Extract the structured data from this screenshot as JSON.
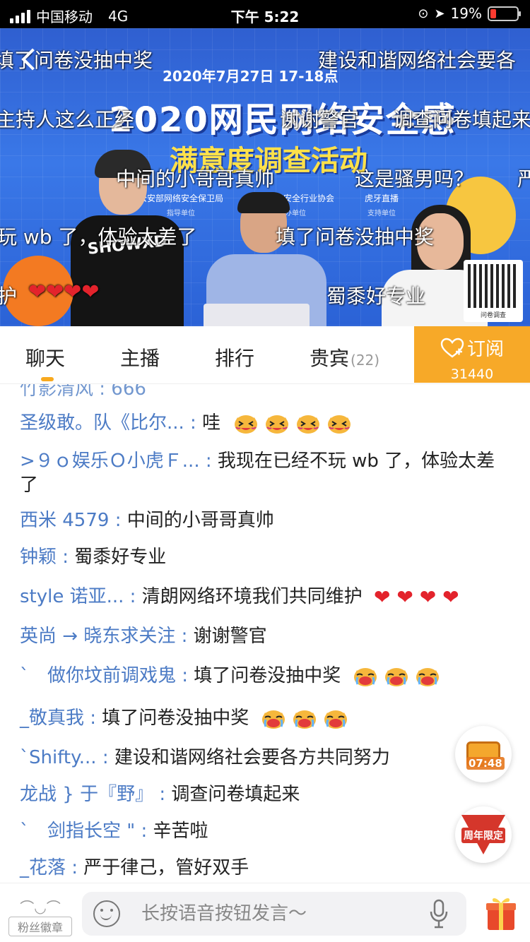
{
  "status": {
    "carrier": "中国移动",
    "network": "4G",
    "time": "下午 5:22",
    "battery": "19%"
  },
  "video": {
    "date_text": "2020年7月27日 17-18点",
    "title": "2020网民网络安全感",
    "subtitle": "满意度调查活动",
    "orgs": [
      {
        "name": "公安部网络安全保卫局",
        "role": "指导单位"
      },
      {
        "name": "全国网络安全行业协会",
        "role": "主办单位"
      },
      {
        "name": "虎牙直播",
        "role": "支持单位"
      }
    ],
    "qr_caption": "问卷调查",
    "mascot_text": "SHOWXD",
    "danmaku": [
      "填了问卷没抽中奖",
      "建设和谐网络社会要各",
      "主持人这么正经",
      "谢谢警官",
      "调查问卷填起来",
      "中间的小哥哥真帅",
      "这是骚男吗？",
      "严",
      "玩 wb 了，体验太差了",
      "填了问卷没抽中奖",
      "护",
      "蜀黍好专业"
    ]
  },
  "tabs": {
    "chat": "聊天",
    "host": "主播",
    "rank": "排行",
    "vip": "贵宾",
    "vip_count": "(22)",
    "subscribe": "订阅",
    "subscribe_count": "31440"
  },
  "chat": {
    "partial_top": "竹影清风 : 666",
    "messages": [
      {
        "user": "圣级敢。队《比尔... : ",
        "text": "哇",
        "emoji": "tiger-laugh",
        "emoji_count": 4
      },
      {
        "user": ">９ｏ娱乐Ｏ小虎Ｆ... : ",
        "text": "我现在已经不玩 wb 了，体验太差了"
      },
      {
        "user": "西米 4579 : ",
        "text": "中间的小哥哥真帅"
      },
      {
        "user": "钟颖 : ",
        "text": "蜀黍好专业"
      },
      {
        "user": "style 诺亚... : ",
        "text": "清朗网络环境我们共同维护",
        "hearts": 4
      },
      {
        "user": "英尚 → 晓东求关注 : ",
        "text": "谢谢警官"
      },
      {
        "user": "ˋ　做你坟前调戏鬼 : ",
        "text": "填了问卷没抽中奖",
        "emoji": "tiger-cry",
        "emoji_count": 3
      },
      {
        "user": "_敬真我 : ",
        "text": "填了问卷没抽中奖",
        "emoji": "tiger-cry",
        "emoji_count": 3
      },
      {
        "user": "`Shifty... : ",
        "text": "建设和谐网络社会要各方共同努力"
      },
      {
        "user": "龙战 } 于『野』 : ",
        "text": "调查问卷填起来"
      },
      {
        "user": "ˋ　剑指长空 \" : ",
        "text": "辛苦啦"
      },
      {
        "user": "_花落 : ",
        "text": "严于律己，管好双手"
      }
    ]
  },
  "chest_timer": "07:48",
  "anniversary_label": "周年限定",
  "bottom": {
    "fan_badge": "粉丝徽章",
    "input_placeholder": "长按语音按钮发言～"
  },
  "colors": {
    "accent": "#f7a928",
    "username": "#4c7bc5",
    "heart": "#e3232c"
  }
}
